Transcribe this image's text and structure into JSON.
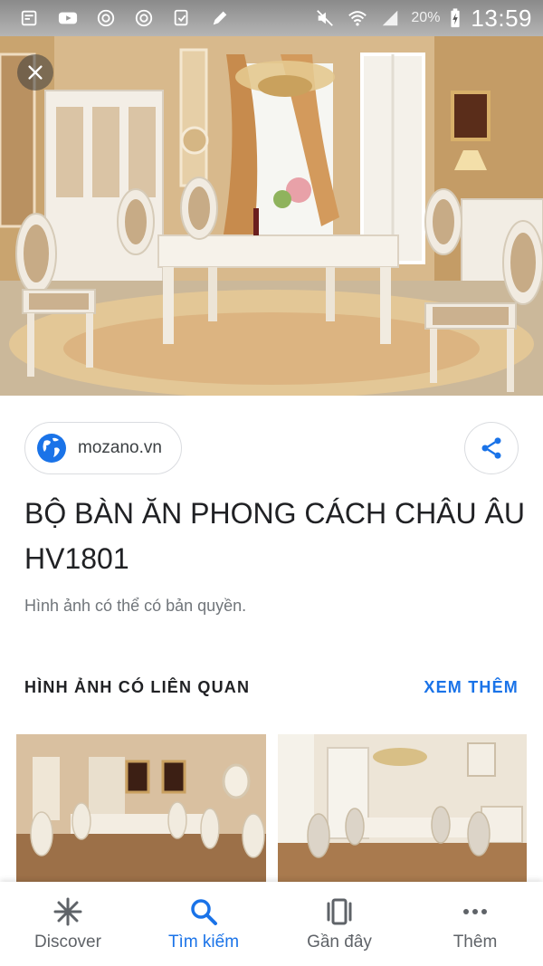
{
  "status_bar": {
    "battery": "20%",
    "time": "13:59"
  },
  "close_label": "close",
  "source": {
    "domain": "mozano.vn"
  },
  "title": "BỘ BÀN ĂN PHONG CÁCH CHÂU ÂU HV1801",
  "copyright_note": "Hình ảnh có thể có bản quyền.",
  "related": {
    "heading": "HÌNH ẢNH CÓ LIÊN QUAN",
    "see_more": "XEM THÊM"
  },
  "bottom_nav": {
    "items": [
      {
        "label": "Discover",
        "icon": "asterisk-icon"
      },
      {
        "label": "Tìm kiếm",
        "icon": "search-icon"
      },
      {
        "label": "Gần đây",
        "icon": "recent-cards-icon"
      },
      {
        "label": "Thêm",
        "icon": "more-dots-icon"
      }
    ],
    "active_index": 1
  },
  "colors": {
    "accent": "#1a73e8",
    "nav_inactive": "#5f6368"
  }
}
